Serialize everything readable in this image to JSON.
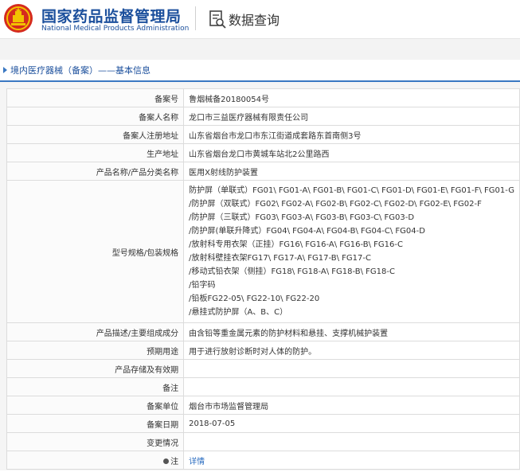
{
  "header": {
    "title_cn": "国家药品监督管理局",
    "title_en": "National Medical Products Administration",
    "search_title": "数据查询"
  },
  "breadcrumb": {
    "text": "境内医疗器械（备案）——基本信息"
  },
  "colors": {
    "brand": "#1b4f9c",
    "accent": "#3a78c2",
    "logo_red": "#d52b1e",
    "logo_gold": "#f2c200"
  },
  "rows": [
    {
      "label": "备案号",
      "value": "鲁烟械备20180054号"
    },
    {
      "label": "备案人名称",
      "value": "龙口市三益医疗器械有限责任公司"
    },
    {
      "label": "备案人注册地址",
      "value": "山东省烟台市龙口市东江街道成套路东首南侧3号"
    },
    {
      "label": "生产地址",
      "value": "山东省烟台龙口市黄城车站北2公里路西"
    },
    {
      "label": "产品名称/产品分类名称",
      "value": "医用X射线防护装置"
    }
  ],
  "model_row": {
    "label": "型号规格/包装规格",
    "lines": [
      "防护屏（单联式）FG01\\ FG01-A\\ FG01-B\\ FG01-C\\ FG01-D\\ FG01-E\\ FG01-F\\ FG01-G",
      "/防护屏（双联式）FG02\\ FG02-A\\ FG02-B\\ FG02-C\\ FG02-D\\ FG02-E\\ FG02-F",
      "/防护屏（三联式）FG03\\ FG03-A\\ FG03-B\\ FG03-C\\ FG03-D",
      "/防护屏(单联升降式）FG04\\ FG04-A\\ FG04-B\\ FG04-C\\ FG04-D",
      "/放射科专用衣架（正挂）FG16\\ FG16-A\\ FG16-B\\ FG16-C",
      "/放射科壁挂衣架FG17\\ FG17-A\\ FG17-B\\ FG17-C",
      "/移动式铅衣架（侧挂）FG18\\ FG18-A\\ FG18-B\\ FG18-C",
      "/铅字码",
      "/铅板FG22-05\\ FG22-10\\ FG22-20",
      "/悬挂式防护屏（A、B、C）"
    ]
  },
  "rows2": [
    {
      "label": "产品描述/主要组成成分",
      "value": "由含铅等重金属元素的防护材料和悬挂、支撑机械护装置"
    },
    {
      "label": "预期用途",
      "value": "用于进行放射诊断时对人体的防护。"
    },
    {
      "label": "产品存储及有效期",
      "value": ""
    },
    {
      "label": "备注",
      "value": ""
    },
    {
      "label": "备案单位",
      "value": "烟台市市场监督管理局"
    },
    {
      "label": "备案日期",
      "value": "2018-07-05"
    },
    {
      "label": "变更情况",
      "value": ""
    }
  ],
  "detail_row": {
    "label": "注",
    "link": "详情"
  }
}
